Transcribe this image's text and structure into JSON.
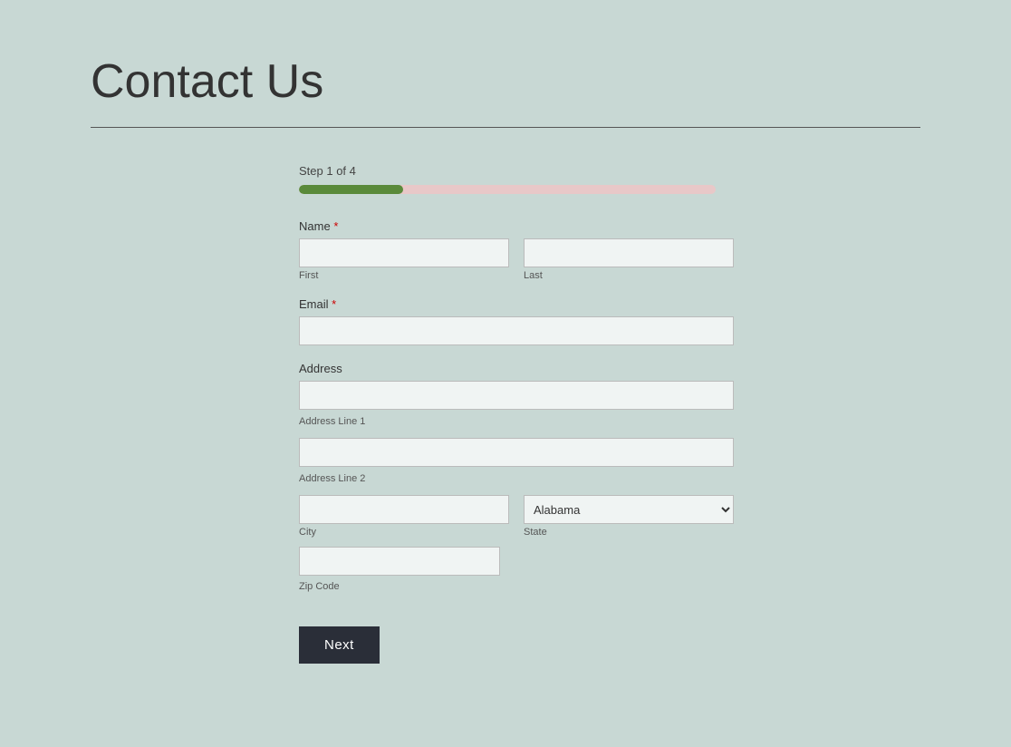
{
  "page": {
    "title": "Contact Us",
    "divider": true
  },
  "form": {
    "step_label": "Step 1 of 4",
    "progress_percent": 25,
    "name_field": {
      "label": "Name",
      "required": true,
      "first_label": "First",
      "last_label": "Last"
    },
    "email_field": {
      "label": "Email",
      "required": true
    },
    "address_field": {
      "label": "Address",
      "line1_label": "Address Line 1",
      "line2_label": "Address Line 2",
      "city_label": "City",
      "state_label": "State",
      "state_default": "Alabama",
      "zip_label": "Zip Code"
    },
    "next_button_label": "Next",
    "required_marker": "*"
  }
}
